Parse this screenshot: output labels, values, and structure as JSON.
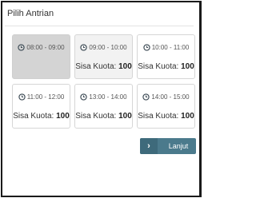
{
  "dialog": {
    "title": "Pilih Antrian"
  },
  "slots": [
    {
      "time": "08:00 - 09:00",
      "quota_label": "",
      "quota_value": "",
      "state": "disabled"
    },
    {
      "time": "09:00 - 10:00",
      "quota_label": "Sisa Kuota:",
      "quota_value": "100",
      "state": "hover"
    },
    {
      "time": "10:00 - 11:00",
      "quota_label": "Sisa Kuota:",
      "quota_value": "100",
      "state": "normal"
    },
    {
      "time": "11:00 - 12:00",
      "quota_label": "Sisa Kuota:",
      "quota_value": "100",
      "state": "normal"
    },
    {
      "time": "13:00 - 14:00",
      "quota_label": "Sisa Kuota:",
      "quota_value": "100",
      "state": "normal"
    },
    {
      "time": "14:00 - 15:00",
      "quota_label": "Sisa Kuota:",
      "quota_value": "100",
      "state": "normal"
    }
  ],
  "actions": {
    "next_label": "Lanjut",
    "next_icon": "chevron-right-icon"
  },
  "colors": {
    "accent": "#4b7a8c",
    "clock": "#3f4d57",
    "disabled_bg": "#d4d4d4"
  }
}
